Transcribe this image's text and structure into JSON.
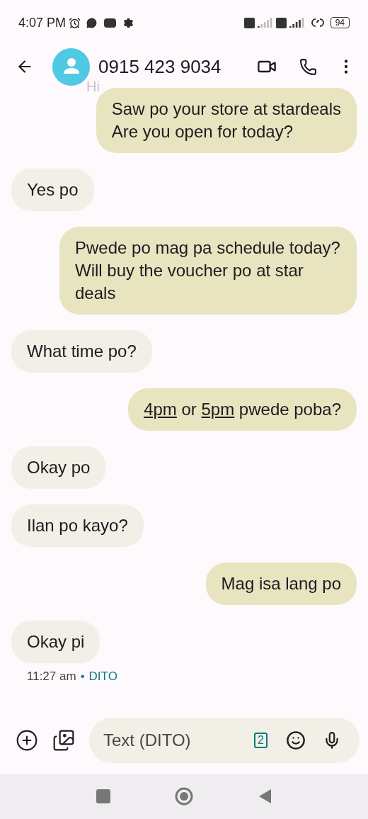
{
  "status_bar": {
    "time": "4:07 PM",
    "battery": "94"
  },
  "header": {
    "contact": "0915 423 9034"
  },
  "hidden_message": {
    "text": "Hi"
  },
  "messages": [
    {
      "kind": "sent",
      "parts": [
        {
          "text": "Saw po your store at stardeals\nAre you open for today?",
          "link": false
        }
      ]
    },
    {
      "kind": "received",
      "parts": [
        {
          "text": "Yes po",
          "link": false
        }
      ]
    },
    {
      "kind": "sent",
      "parts": [
        {
          "text": "Pwede po mag pa schedule today?\nWill buy the voucher po at star deals",
          "link": false
        }
      ]
    },
    {
      "kind": "received",
      "parts": [
        {
          "text": "What time po?",
          "link": false
        }
      ]
    },
    {
      "kind": "sent",
      "parts": [
        {
          "text": "4pm",
          "link": true
        },
        {
          "text": " or ",
          "link": false
        },
        {
          "text": "5pm",
          "link": true
        },
        {
          "text": " pwede poba?",
          "link": false
        }
      ]
    },
    {
      "kind": "received",
      "parts": [
        {
          "text": "Okay po",
          "link": false
        }
      ]
    },
    {
      "kind": "received",
      "parts": [
        {
          "text": "Ilan po kayo?",
          "link": false
        }
      ]
    },
    {
      "kind": "sent",
      "parts": [
        {
          "text": "Mag isa lang po",
          "link": false
        }
      ]
    },
    {
      "kind": "received",
      "parts": [
        {
          "text": "Okay pi",
          "link": false
        }
      ]
    }
  ],
  "last_meta": {
    "time": "11:27 am",
    "separator": "•",
    "carrier": "DITO"
  },
  "composer": {
    "placeholder": "Text (DITO)",
    "sim": "2"
  }
}
